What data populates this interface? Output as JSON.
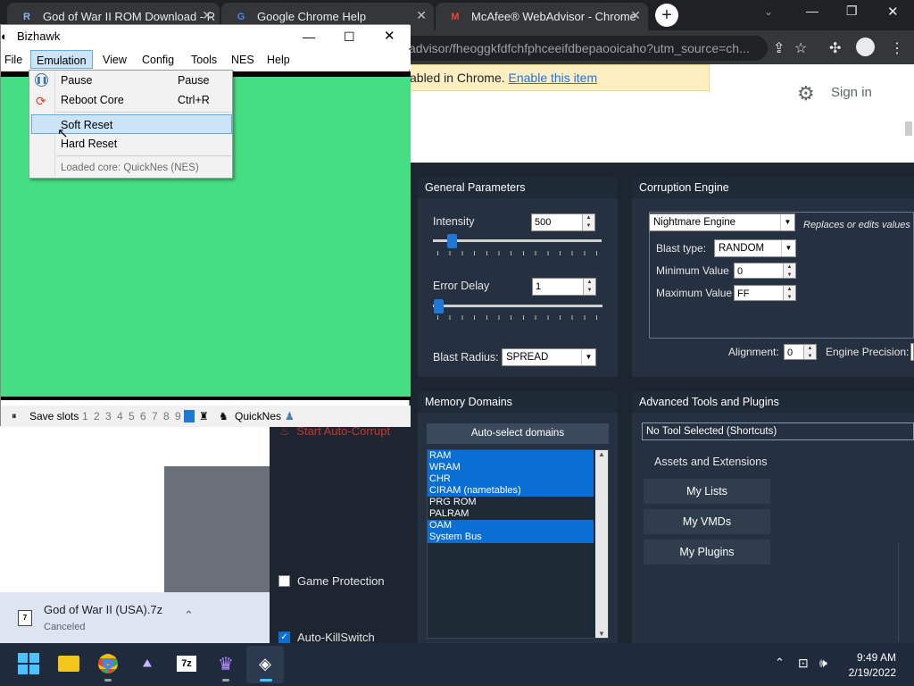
{
  "chrome": {
    "tabs": [
      {
        "title": "God of War II ROM Download - R",
        "icon": "rom-site-icon"
      },
      {
        "title": "Google Chrome Help",
        "icon": "google-icon"
      },
      {
        "title": "McAfee® WebAdvisor - Chrome",
        "icon": "mcafee-icon"
      }
    ],
    "new_tab_label": "+",
    "url": "advisor/fheoggkfdfchfphceeifdbepaooicaho?utm_source=ch...",
    "infobar_text": "abled in Chrome.",
    "infobar_link": "Enable this item",
    "sign_in": "Sign in"
  },
  "bizhawk": {
    "title": "Bizhawk",
    "menu": [
      "File",
      "Emulation",
      "View",
      "Config",
      "Tools",
      "NES",
      "Help"
    ],
    "emulation_menu": [
      {
        "label": "Pause",
        "shortcut": "Pause"
      },
      {
        "label": "Reboot Core",
        "shortcut": "Ctrl+R"
      },
      {
        "label": "Soft Reset",
        "shortcut": ""
      },
      {
        "label": "Hard Reset",
        "shortcut": ""
      },
      {
        "label": "Loaded core: QuickNes (NES)",
        "shortcut": ""
      }
    ],
    "status": {
      "save_slots_label": "Save slots",
      "slots": [
        "1",
        "2",
        "3",
        "4",
        "5",
        "6",
        "7",
        "8",
        "9"
      ],
      "core": "QuickNes"
    },
    "game_bg": "#45de84"
  },
  "rtc": {
    "start_autocorrupt": "Start Auto-Corrupt",
    "game_protection": "Game Protection",
    "auto_killswitch": "Auto-KillSwitch",
    "general": {
      "title": "General Parameters",
      "intensity_label": "Intensity",
      "intensity_value": "500",
      "error_delay_label": "Error Delay",
      "error_delay_value": "1",
      "blast_radius_label": "Blast Radius:",
      "blast_radius_value": "SPREAD"
    },
    "engine": {
      "title": "Corruption Engine",
      "engine_value": "Nightmare Engine",
      "engine_note": "Replaces or edits values",
      "blast_type_label": "Blast type:",
      "blast_type_value": "RANDOM",
      "min_label": "Minimum Value",
      "min_value": "0",
      "max_label": "Maximum Value",
      "max_value": "FF",
      "alignment_label": "Alignment:",
      "alignment_value": "0",
      "precision_label": "Engine Precision:"
    },
    "memory": {
      "title": "Memory Domains",
      "auto_button": "Auto-select domains",
      "domains": [
        {
          "name": "RAM",
          "selected": true
        },
        {
          "name": "WRAM",
          "selected": true
        },
        {
          "name": "CHR",
          "selected": true
        },
        {
          "name": "CIRAM (nametables)",
          "selected": true
        },
        {
          "name": "PRG ROM",
          "selected": false
        },
        {
          "name": "PALRAM",
          "selected": false
        },
        {
          "name": "OAM",
          "selected": true
        },
        {
          "name": "System Bus",
          "selected": true
        }
      ]
    },
    "advanced": {
      "title": "Advanced Tools and Plugins",
      "tool_select": "No Tool Selected (Shortcuts)",
      "assets_label": "Assets and Extensions",
      "buttons": [
        "My Lists",
        "My VMDs",
        "My Plugins"
      ]
    }
  },
  "download": {
    "filename": "God of War II (USA).7z",
    "status": "Canceled"
  },
  "taskbar": {
    "time": "9:49 AM",
    "date": "2/19/2022"
  },
  "colors": {
    "accent": "#0a6fd4",
    "rtc_bg": "#1c2530",
    "autocorrupt_red": "#c0392b"
  }
}
